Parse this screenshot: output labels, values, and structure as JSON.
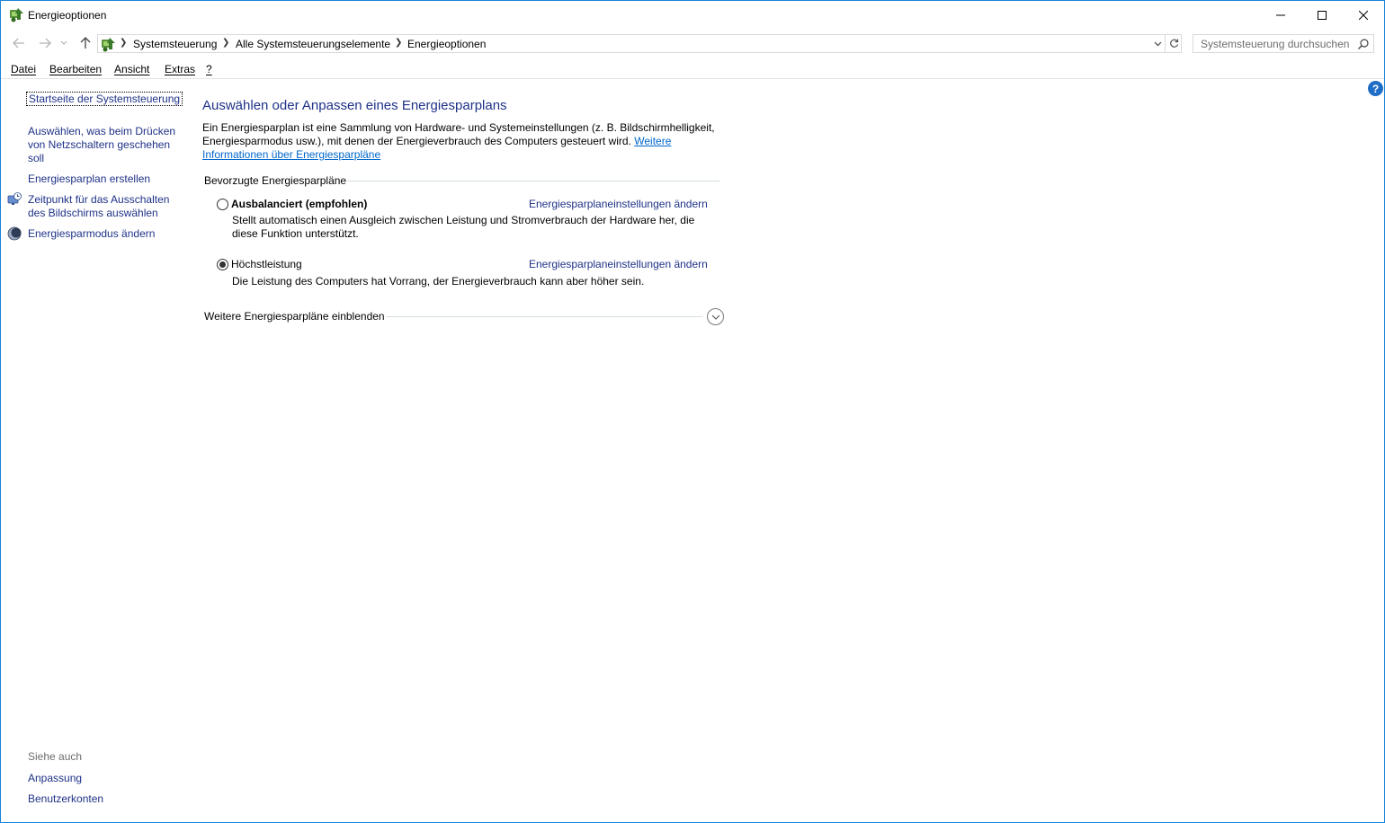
{
  "window": {
    "title": "Energieoptionen",
    "accent": "#1883d7"
  },
  "address": {
    "breadcrumbs": [
      "Systemsteuerung",
      "Alle Systemsteuerungselemente",
      "Energieoptionen"
    ],
    "search_placeholder": "Systemsteuerung durchsuchen"
  },
  "menu": {
    "items": [
      {
        "mnemonic": "D",
        "rest": "atei"
      },
      {
        "mnemonic": "B",
        "rest": "earbeiten"
      },
      {
        "mnemonic": "A",
        "rest": "nsicht"
      },
      {
        "mnemonic": "E",
        "rest": "xtras"
      },
      {
        "mnemonic": "?",
        "rest": ""
      }
    ]
  },
  "sidebar": {
    "home_link": "Startseite der Systemsteuerung",
    "links": [
      {
        "label": "Auswählen, was beim Drücken von Netzschaltern geschehen soll",
        "icon": null
      },
      {
        "label": "Energiesparplan erstellen",
        "icon": null
      },
      {
        "label": "Zeitpunkt für das Ausschalten des Bildschirms auswählen",
        "icon": "monitor-clock-icon"
      },
      {
        "label": "Energiesparmodus ändern",
        "icon": "moon-icon"
      }
    ],
    "see_also_title": "Siehe auch",
    "see_also": [
      "Anpassung",
      "Benutzerkonten"
    ]
  },
  "main": {
    "heading": "Auswählen oder Anpassen eines Energiesparplans",
    "intro_text": "Ein Energiesparplan ist eine Sammlung von Hardware- und Systemeinstellungen (z. B. Bildschirmhelligkeit, Energiesparmodus usw.), mit denen der Energieverbrauch des Computers gesteuert wird. ",
    "intro_link": "Weitere Informationen über Energiesparpläne",
    "group_title": "Bevorzugte Energiesparpläne",
    "plans": [
      {
        "name": "Ausbalanciert (empfohlen)",
        "selected": false,
        "settings_link": "Energiesparplaneinstellungen ändern",
        "description": "Stellt automatisch einen Ausgleich zwischen Leistung und Stromverbrauch der Hardware her, die diese Funktion unterstützt."
      },
      {
        "name": "Höchstleistung",
        "selected": true,
        "settings_link": "Energiesparplaneinstellungen ändern",
        "description": "Die Leistung des Computers hat Vorrang, der Energieverbrauch kann aber höher sein."
      }
    ],
    "more_plans": "Weitere Energiesparpläne einblenden"
  },
  "colors": {
    "link": "#1e3287",
    "hyperlink": "#0066cc",
    "help": "#1e6ec8"
  }
}
